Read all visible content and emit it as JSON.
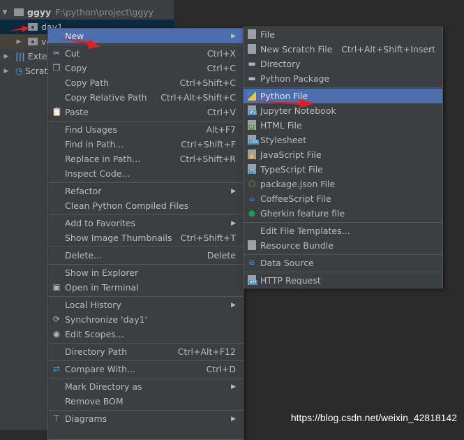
{
  "tree": {
    "root_name": "ggyy",
    "root_path": "F:\\python\\project\\ggyy",
    "items": [
      "day1",
      "ve",
      "External Libraries",
      "Scratches and Consoles"
    ],
    "visible_items": [
      "day1",
      "ve",
      "Exter",
      "Scrat"
    ]
  },
  "context_menu": [
    {
      "label": "New",
      "submenu": true,
      "selected": true
    },
    {
      "sep": true
    },
    {
      "label": "Cut",
      "shortcut": "Ctrl+X",
      "icon": "scissors-icon"
    },
    {
      "label": "Copy",
      "shortcut": "Ctrl+C",
      "icon": "copy-icon"
    },
    {
      "label": "Copy Path",
      "shortcut": "Ctrl+Shift+C"
    },
    {
      "label": "Copy Relative Path",
      "shortcut": "Ctrl+Alt+Shift+C"
    },
    {
      "label": "Paste",
      "shortcut": "Ctrl+V",
      "icon": "paste-icon"
    },
    {
      "sep": true
    },
    {
      "label": "Find Usages",
      "shortcut": "Alt+F7"
    },
    {
      "label": "Find in Path...",
      "shortcut": "Ctrl+Shift+F"
    },
    {
      "label": "Replace in Path...",
      "shortcut": "Ctrl+Shift+R"
    },
    {
      "label": "Inspect Code..."
    },
    {
      "sep": true
    },
    {
      "label": "Refactor",
      "submenu": true
    },
    {
      "label": "Clean Python Compiled Files"
    },
    {
      "sep": true
    },
    {
      "label": "Add to Favorites",
      "submenu": true
    },
    {
      "label": "Show Image Thumbnails",
      "shortcut": "Ctrl+Shift+T"
    },
    {
      "sep": true
    },
    {
      "label": "Delete...",
      "shortcut": "Delete"
    },
    {
      "sep": true
    },
    {
      "label": "Show in Explorer"
    },
    {
      "label": "Open in Terminal",
      "icon": "terminal-icon"
    },
    {
      "sep": true
    },
    {
      "label": "Local History",
      "submenu": true
    },
    {
      "label": "Synchronize 'day1'",
      "icon": "sync-icon"
    },
    {
      "label": "Edit Scopes...",
      "icon": "scope-icon"
    },
    {
      "sep": true
    },
    {
      "label": "Directory Path",
      "shortcut": "Ctrl+Alt+F12"
    },
    {
      "sep": true
    },
    {
      "label": "Compare With...",
      "shortcut": "Ctrl+D",
      "icon": "compare-icon"
    },
    {
      "sep": true
    },
    {
      "label": "Mark Directory as",
      "submenu": true
    },
    {
      "label": "Remove BOM"
    },
    {
      "sep": true
    },
    {
      "label": "Diagrams",
      "submenu": true,
      "icon": "diagram-icon"
    }
  ],
  "new_submenu": [
    {
      "label": "File",
      "icon": "file-icon"
    },
    {
      "label": "New Scratch File",
      "shortcut": "Ctrl+Alt+Shift+Insert",
      "icon": "scratch-file-icon"
    },
    {
      "label": "Directory",
      "icon": "folder-icon"
    },
    {
      "label": "Python Package",
      "icon": "package-icon"
    },
    {
      "sep": true
    },
    {
      "label": "Python File",
      "icon": "python-file-icon",
      "selected": true
    },
    {
      "label": "Jupyter Notebook",
      "icon": "jupyter-icon",
      "badge": "IPy",
      "color": "#3d8fc7"
    },
    {
      "label": "HTML File",
      "icon": "html-file-icon",
      "badge": "H",
      "color": "#5f8a3a"
    },
    {
      "label": "Stylesheet",
      "icon": "css-file-icon",
      "badge": "CSS",
      "color": "#3d8fc7"
    },
    {
      "label": "JavaScript File",
      "icon": "js-file-icon",
      "badge": "JS",
      "color": "#c59431"
    },
    {
      "label": "TypeScript File",
      "icon": "ts-file-icon",
      "badge": "TS",
      "color": "#3d8fc7"
    },
    {
      "label": "package.json File",
      "icon": "nodejs-icon"
    },
    {
      "label": "CoffeeScript File",
      "icon": "coffeescript-icon"
    },
    {
      "label": "Gherkin feature file",
      "icon": "gherkin-icon"
    },
    {
      "sep": true
    },
    {
      "label": "Edit File Templates..."
    },
    {
      "label": "Resource Bundle",
      "icon": "resource-bundle-icon"
    },
    {
      "sep": true
    },
    {
      "label": "Data Source",
      "icon": "database-icon"
    },
    {
      "sep": true
    },
    {
      "label": "HTTP Request",
      "icon": "api-icon",
      "badge": "API",
      "color": "#3d8fc7"
    }
  ],
  "watermark": "https://blog.csdn.net/weixin_42818142",
  "colors": {
    "selection": "#4b6eaf",
    "annotation_arrow": "#e02020"
  }
}
